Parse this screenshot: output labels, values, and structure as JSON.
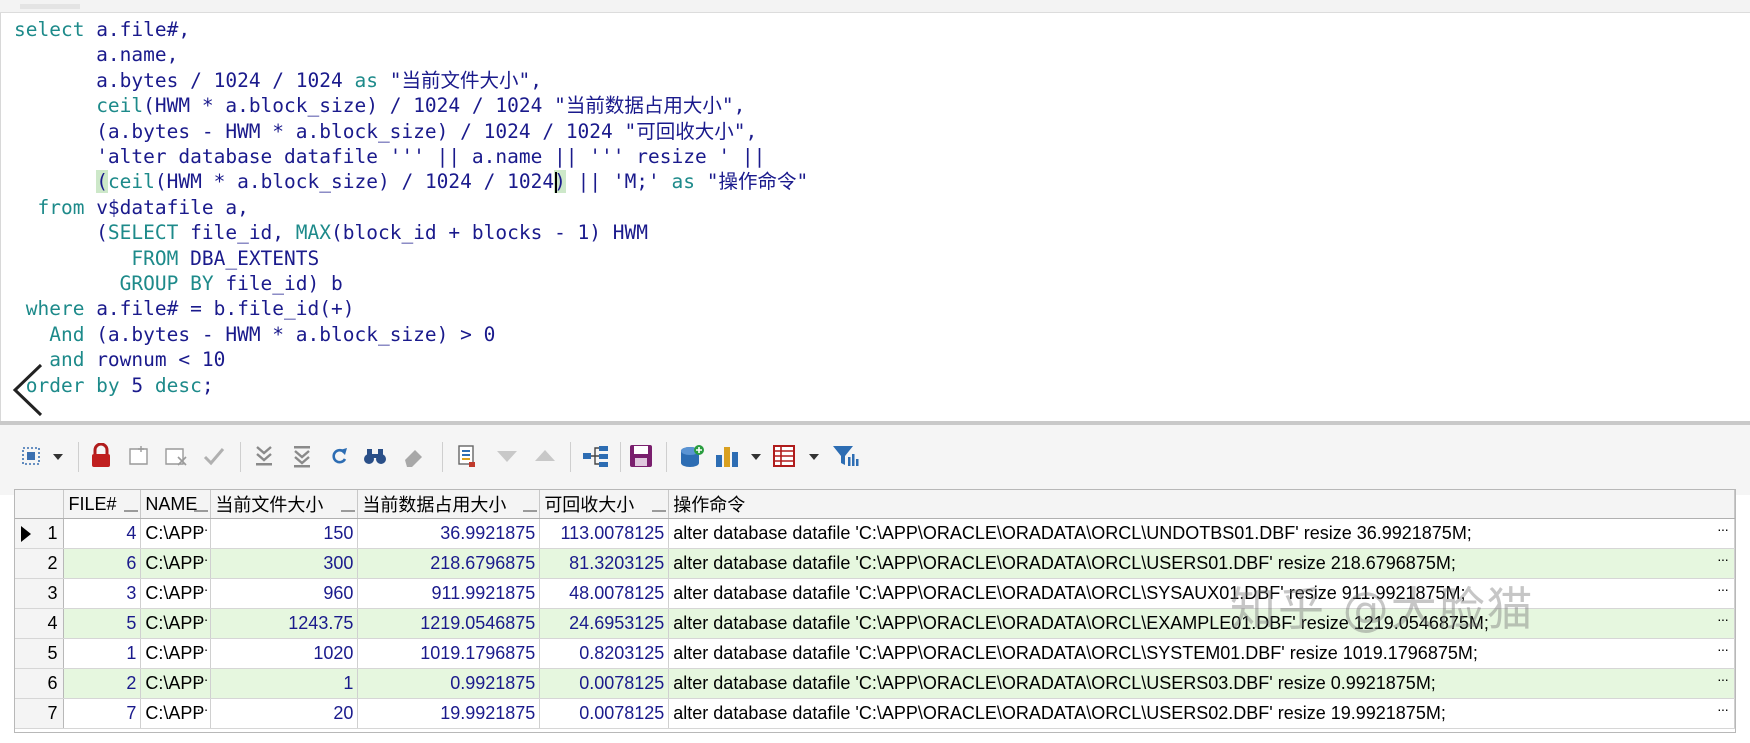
{
  "editor": {
    "sql_lines": [
      [
        [
          "kw",
          "select"
        ],
        [
          "op",
          " a.file#,"
        ]
      ],
      [
        [
          "op",
          "       a.name,"
        ]
      ],
      [
        [
          "op",
          "       a.bytes / "
        ],
        [
          "num",
          "1024"
        ],
        [
          "op",
          " / "
        ],
        [
          "num",
          "1024"
        ],
        [
          "op",
          " "
        ],
        [
          "kw",
          "as"
        ],
        [
          "str",
          " \"当前文件大小\","
        ]
      ],
      [
        [
          "op",
          "       "
        ],
        [
          "fn",
          "ceil"
        ],
        [
          "op",
          "(HWM * a.block_size) / "
        ],
        [
          "num",
          "1024"
        ],
        [
          "op",
          " / "
        ],
        [
          "num",
          "1024"
        ],
        [
          "str",
          " \"当前数据占用大小\","
        ]
      ],
      [
        [
          "op",
          "       (a.bytes - HWM * a.block_size) / "
        ],
        [
          "num",
          "1024"
        ],
        [
          "op",
          " / "
        ],
        [
          "num",
          "1024"
        ],
        [
          "str",
          " \"可回收大小\","
        ]
      ],
      [
        [
          "op",
          "       "
        ],
        [
          "str",
          "'alter database datafile '''"
        ],
        [
          "op",
          " || a.name || "
        ],
        [
          "str",
          "''' resize '"
        ],
        [
          "op",
          " ||"
        ]
      ],
      [
        [
          "op",
          "       "
        ],
        [
          "hl",
          "("
        ],
        [
          "fn",
          "ceil"
        ],
        [
          "op",
          "(HWM * a.block_size) / "
        ],
        [
          "num",
          "1024"
        ],
        [
          "op",
          " / "
        ],
        [
          "num",
          "1024"
        ],
        [
          "hl",
          ")"
        ],
        [
          "op",
          " || "
        ],
        [
          "str",
          "'M;'"
        ],
        [
          "op",
          " "
        ],
        [
          "kw",
          "as"
        ],
        [
          "str",
          " \"操作命令\""
        ]
      ],
      [
        [
          "kw",
          "  from"
        ],
        [
          "op",
          " v$datafile a,"
        ]
      ],
      [
        [
          "op",
          "       ("
        ],
        [
          "kw",
          "SELECT"
        ],
        [
          "op",
          " file_id, "
        ],
        [
          "fn",
          "MAX"
        ],
        [
          "op",
          "(block_id + blocks - 1) HWM"
        ]
      ],
      [
        [
          "kw",
          "          FROM"
        ],
        [
          "op",
          " DBA_EXTENTS"
        ]
      ],
      [
        [
          "kw",
          "         GROUP BY"
        ],
        [
          "op",
          " file_id) b"
        ]
      ],
      [
        [
          "kw",
          " where"
        ],
        [
          "op",
          " a.file# = b.file_id(+)"
        ]
      ],
      [
        [
          "kw",
          "   And"
        ],
        [
          "op",
          " (a.bytes - HWM * a.block_size) > 0"
        ]
      ],
      [
        [
          "kw",
          "   and"
        ],
        [
          "op",
          " rownum < 10"
        ]
      ],
      [
        [
          "kw",
          " order by"
        ],
        [
          "op",
          " 5 "
        ],
        [
          "kw",
          "desc"
        ],
        [
          "op",
          ";"
        ]
      ]
    ]
  },
  "grid": {
    "columns": [
      "FILE#",
      "NAME",
      "当前文件大小",
      "当前数据占用大小",
      "可回收大小",
      "操作命令"
    ],
    "rows": [
      {
        "rownum": "1",
        "file": "4",
        "name": "C:\\APP",
        "size": "150",
        "used": "36.9921875",
        "reclaim": "113.0078125",
        "cmd": "alter database datafile 'C:\\APP\\ORACLE\\ORADATA\\ORCL\\UNDOTBS01.DBF' resize 36.9921875M;"
      },
      {
        "rownum": "2",
        "file": "6",
        "name": "C:\\APP",
        "size": "300",
        "used": "218.6796875",
        "reclaim": "81.3203125",
        "cmd": "alter database datafile 'C:\\APP\\ORACLE\\ORADATA\\ORCL\\USERS01.DBF' resize 218.6796875M;"
      },
      {
        "rownum": "3",
        "file": "3",
        "name": "C:\\APP",
        "size": "960",
        "used": "911.9921875",
        "reclaim": "48.0078125",
        "cmd": "alter database datafile 'C:\\APP\\ORACLE\\ORADATA\\ORCL\\SYSAUX01.DBF' resize 911.9921875M;"
      },
      {
        "rownum": "4",
        "file": "5",
        "name": "C:\\APP",
        "size": "1243.75",
        "used": "1219.0546875",
        "reclaim": "24.6953125",
        "cmd": "alter database datafile 'C:\\APP\\ORACLE\\ORADATA\\ORCL\\EXAMPLE01.DBF' resize 1219.0546875M;"
      },
      {
        "rownum": "5",
        "file": "1",
        "name": "C:\\APP",
        "size": "1020",
        "used": "1019.1796875",
        "reclaim": "0.8203125",
        "cmd": "alter database datafile 'C:\\APP\\ORACLE\\ORADATA\\ORCL\\SYSTEM01.DBF' resize 1019.1796875M;"
      },
      {
        "rownum": "6",
        "file": "2",
        "name": "C:\\APP",
        "size": "1",
        "used": "0.9921875",
        "reclaim": "0.0078125",
        "cmd": "alter database datafile 'C:\\APP\\ORACLE\\ORADATA\\ORCL\\USERS03.DBF' resize 0.9921875M;"
      },
      {
        "rownum": "7",
        "file": "7",
        "name": "C:\\APP",
        "size": "20",
        "used": "19.9921875",
        "reclaim": "0.0078125",
        "cmd": "alter database datafile 'C:\\APP\\ORACLE\\ORADATA\\ORCL\\USERS02.DBF' resize 19.9921875M;"
      }
    ],
    "ellipsis": "···"
  },
  "watermark": "知乎 @大脸猫",
  "colors": {
    "keyword": "#1d8a8a",
    "identifier": "#1a1a8c",
    "row_alt": "#e6f7df",
    "highlight": "#cde8c9"
  }
}
